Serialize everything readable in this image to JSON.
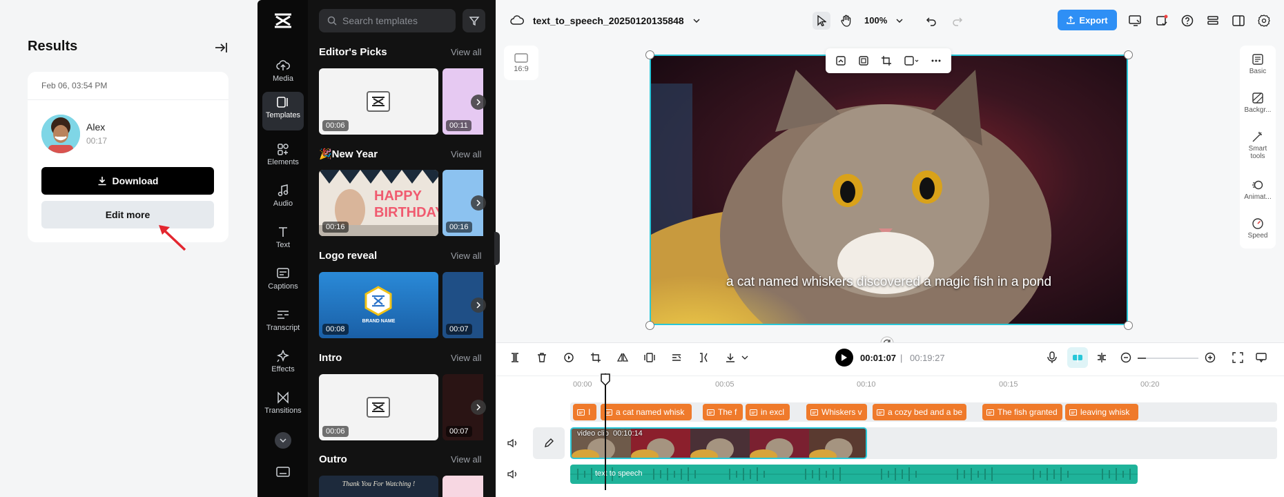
{
  "results": {
    "title": "Results",
    "card": {
      "date": "Feb 06, 03:54 PM",
      "user_name": "Alex",
      "duration": "00:17",
      "download_label": "Download",
      "edit_more_label": "Edit more"
    }
  },
  "rail": {
    "items": [
      {
        "label": "Media",
        "icon": "cloud-upload-icon"
      },
      {
        "label": "Templates",
        "icon": "templates-icon"
      },
      {
        "label": "Elements",
        "icon": "elements-icon"
      },
      {
        "label": "Audio",
        "icon": "music-note-icon"
      },
      {
        "label": "Text",
        "icon": "text-icon"
      },
      {
        "label": "Captions",
        "icon": "captions-icon"
      },
      {
        "label": "Transcript",
        "icon": "transcript-icon"
      },
      {
        "label": "Effects",
        "icon": "sparkle-icon"
      },
      {
        "label": "Transitions",
        "icon": "transition-icon"
      }
    ],
    "active": "Templates"
  },
  "templates": {
    "search_placeholder": "Search templates",
    "view_all": "View all",
    "sections": [
      {
        "title": "Editor's Picks",
        "dur1": "00:06",
        "dur2": "00:11"
      },
      {
        "title": "🎉New Year",
        "dur1": "00:16",
        "dur2": "00:16",
        "thumb_text": "HAPPY BIRTHDAY"
      },
      {
        "title": "Logo reveal",
        "dur1": "00:08",
        "dur2": "00:07",
        "thumb_text": "BRAND NAME"
      },
      {
        "title": "Intro",
        "dur1": "00:06",
        "dur2": "00:07"
      },
      {
        "title": "Outro",
        "thumb_text": "Thank You For Watching !"
      }
    ]
  },
  "topbar": {
    "project_name": "text_to_speech_20250120135848",
    "zoom": "100%",
    "export_label": "Export"
  },
  "canvas": {
    "ratio_label": "16:9",
    "caption": "a cat named whiskers discovered a magic fish in a pond"
  },
  "right_panel": {
    "items": [
      "Basic",
      "Backgr...",
      "Smart tools",
      "Animat...",
      "Speed"
    ]
  },
  "timeline": {
    "current_time": "00:01:07",
    "separator": "|",
    "total_time": "00:19:27",
    "ruler": [
      "00:00",
      "00:05",
      "00:10",
      "00:15",
      "00:20"
    ],
    "caption_clips": [
      "I",
      "a cat named whisk",
      "The f",
      "in excl",
      "Whiskers v",
      "a cozy bed and a be",
      "The fish granted",
      "leaving whisk"
    ],
    "video_clip_label": "video clip",
    "video_clip_duration": "00:10:14",
    "audio_clip_label": "text to speech"
  },
  "colors": {
    "accent": "#2e8ff5",
    "selection": "#28c7d8",
    "caption_clip": "#ef7a2b",
    "audio_clip": "#1fb39a"
  }
}
